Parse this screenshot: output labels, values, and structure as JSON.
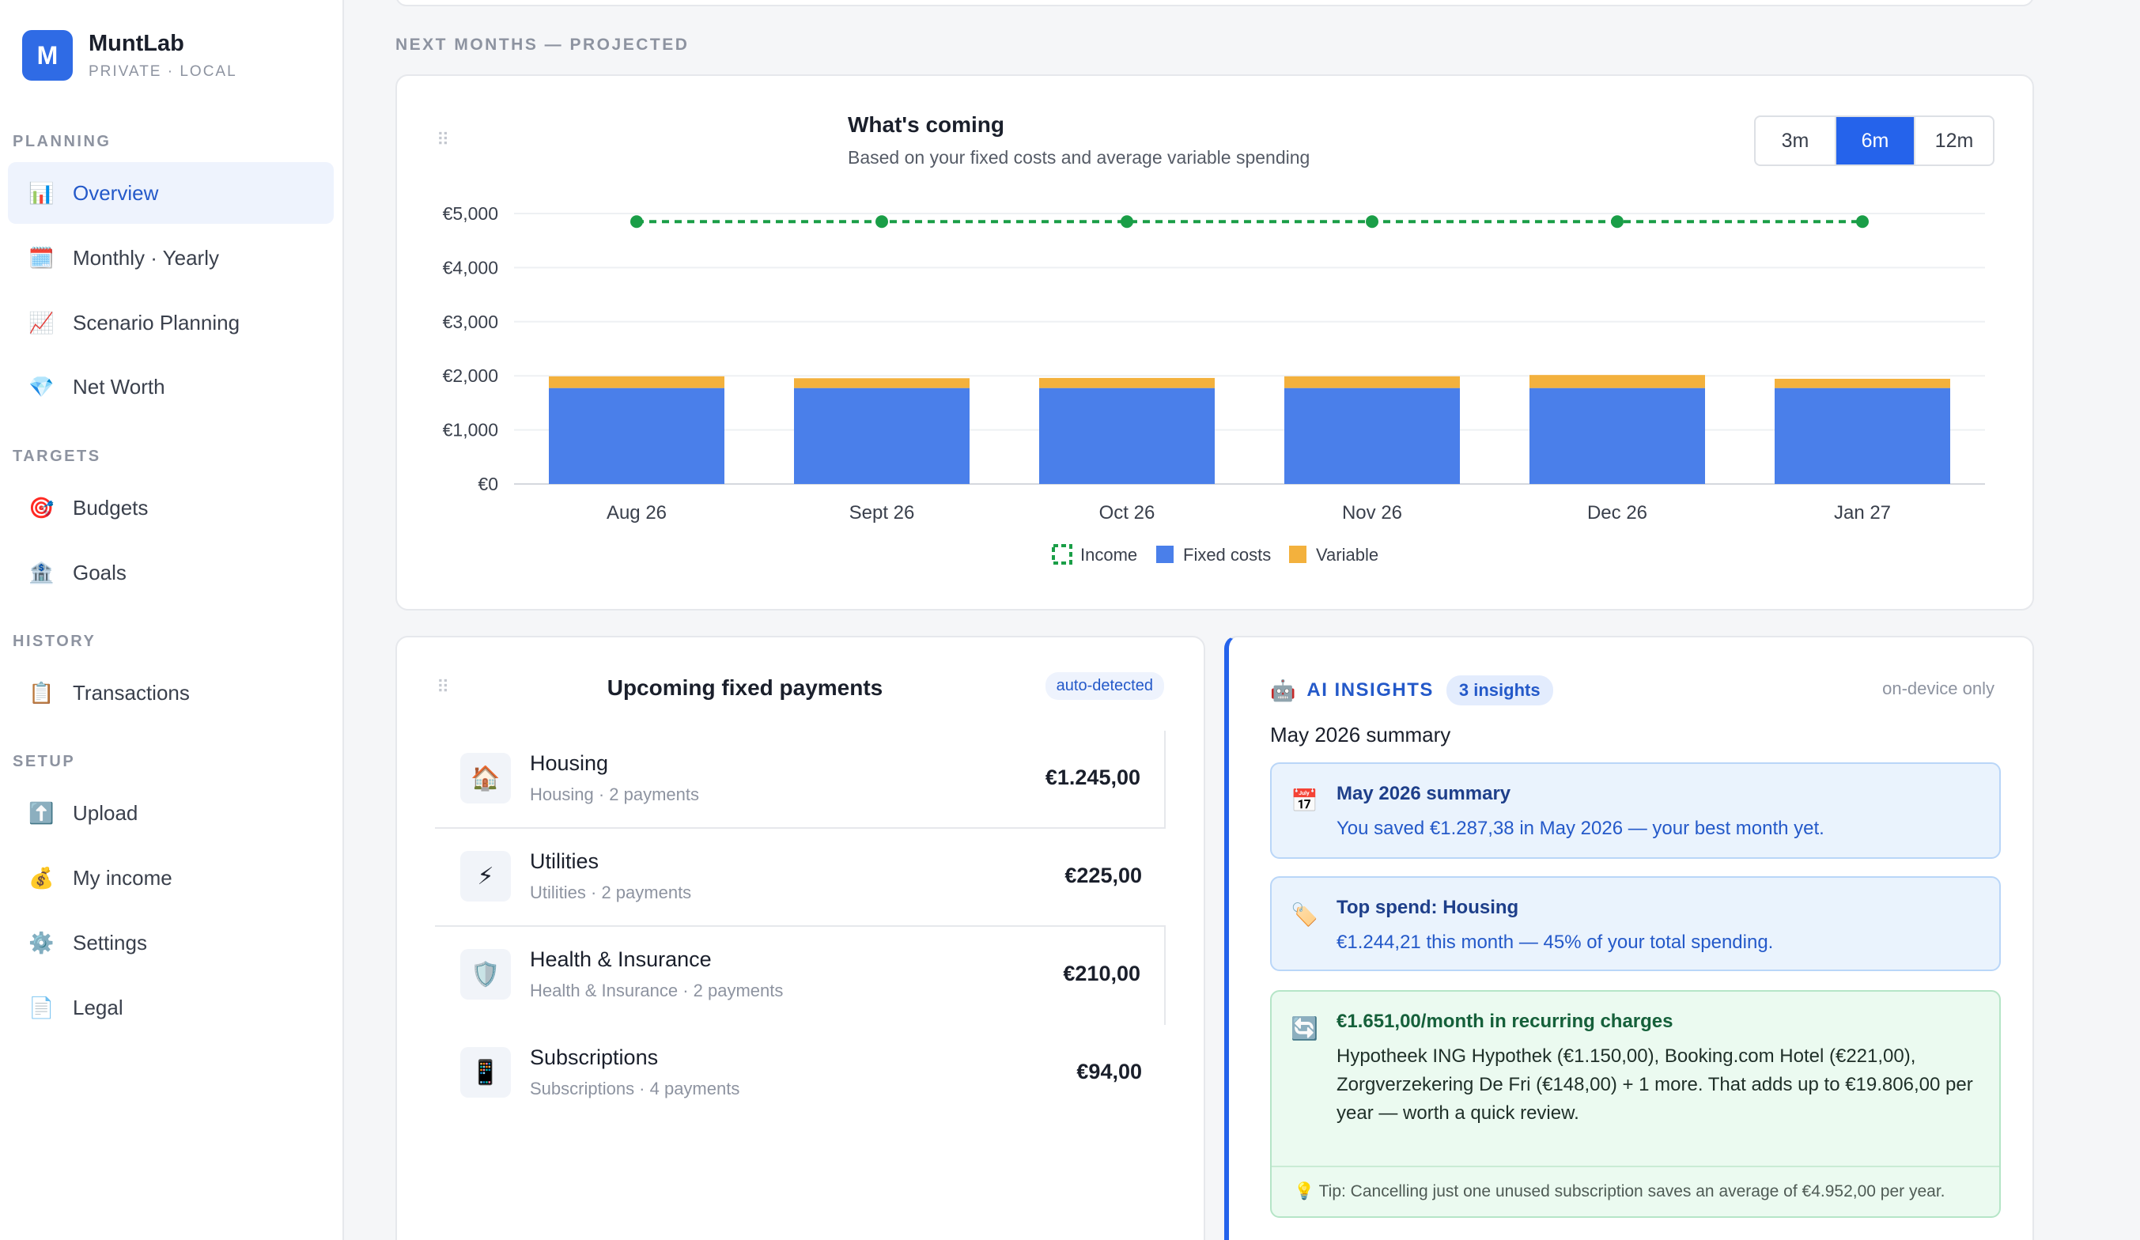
{
  "app": {
    "logo_letter": "M",
    "name": "MuntLab",
    "subtitle": "PRIVATE · LOCAL"
  },
  "sidebar": {
    "sections": [
      {
        "label": "PLANNING",
        "items": [
          {
            "label": "Overview",
            "icon": "📊",
            "active": true
          },
          {
            "label": "Monthly · Yearly",
            "icon": "🗓️"
          },
          {
            "label": "Scenario Planning",
            "icon": "📈"
          },
          {
            "label": "Net Worth",
            "icon": "💎"
          }
        ]
      },
      {
        "label": "TARGETS",
        "items": [
          {
            "label": "Budgets",
            "icon": "🎯"
          },
          {
            "label": "Goals",
            "icon": "🏦"
          }
        ]
      },
      {
        "label": "HISTORY",
        "items": [
          {
            "label": "Transactions",
            "icon": "📋"
          }
        ]
      },
      {
        "label": "SETUP",
        "items": [
          {
            "label": "Upload",
            "icon": "⬆️"
          },
          {
            "label": "My income",
            "icon": "💰"
          },
          {
            "label": "Settings",
            "icon": "⚙️"
          },
          {
            "label": "Legal",
            "icon": "📄"
          }
        ]
      }
    ]
  },
  "main": {
    "section_title": "NEXT MONTHS — PROJECTED",
    "chart_card": {
      "title": "What's coming",
      "subtitle": "Based on your fixed costs and average variable spending",
      "ranges": [
        "3m",
        "6m",
        "12m"
      ],
      "selected_range": "6m"
    },
    "payments": {
      "title": "Upcoming fixed payments",
      "badge": "auto-detected",
      "rows": [
        {
          "icon": "🏠",
          "name": "Housing",
          "meta": "Housing · 2 payments",
          "amount": "€1.245,00"
        },
        {
          "icon": "⚡",
          "name": "Utilities",
          "meta": "Utilities · 2 payments",
          "amount": "€225,00"
        },
        {
          "icon": "🛡️",
          "name": "Health & Insurance",
          "meta": "Health & Insurance · 2 payments",
          "amount": "€210,00"
        },
        {
          "icon": "📱",
          "name": "Subscriptions",
          "meta": "Subscriptions · 4 payments",
          "amount": "€94,00"
        }
      ]
    },
    "insights": {
      "label": "AI INSIGHTS",
      "count": "3 insights",
      "scope": "on-device only",
      "summary_heading": "May 2026 summary",
      "cards": [
        {
          "icon": "📅",
          "title": "May 2026 summary",
          "body": "You saved €1.287,38 in May 2026 — your best month yet.",
          "tone": "blue"
        },
        {
          "icon": "🏷️",
          "title": "Top spend: Housing",
          "body": "€1.244,21 this month — 45% of your total spending.",
          "tone": "blue"
        },
        {
          "icon": "🔄",
          "title": "€1.651,00/month in recurring charges",
          "body": "Hypotheek ING Hypothek (€1.150,00), Booking.com Hotel (€221,00), Zorgverzekering De Fri (€148,00) + 1 more. That adds up to €19.806,00 per year — worth a quick review.",
          "tip": "💡 Tip: Cancelling just one unused subscription saves an average of €4.952,00 per year.",
          "tone": "green"
        }
      ]
    }
  },
  "chart_data": {
    "type": "bar",
    "stacked": true,
    "categories": [
      "Aug 26",
      "Sept 26",
      "Oct 26",
      "Nov 26",
      "Dec 26",
      "Jan 27"
    ],
    "series": [
      {
        "name": "Fixed costs",
        "type": "bar",
        "color": "#4a7fea",
        "values": [
          1774,
          1774,
          1774,
          1774,
          1774,
          1774
        ]
      },
      {
        "name": "Variable",
        "type": "bar",
        "color": "#f3b13d",
        "values": [
          216,
          181,
          186,
          216,
          241,
          171
        ]
      },
      {
        "name": "Income",
        "type": "line",
        "style": "dashed",
        "color": "#1a9e47",
        "values": [
          4850,
          4850,
          4850,
          4850,
          4850,
          4850
        ]
      }
    ],
    "y_ticks": [
      "€0",
      "€1,000",
      "€2,000",
      "€3,000",
      "€4,000",
      "€5,000"
    ],
    "ylim": [
      0,
      5000
    ],
    "grid": true,
    "legend_position": "bottom"
  }
}
